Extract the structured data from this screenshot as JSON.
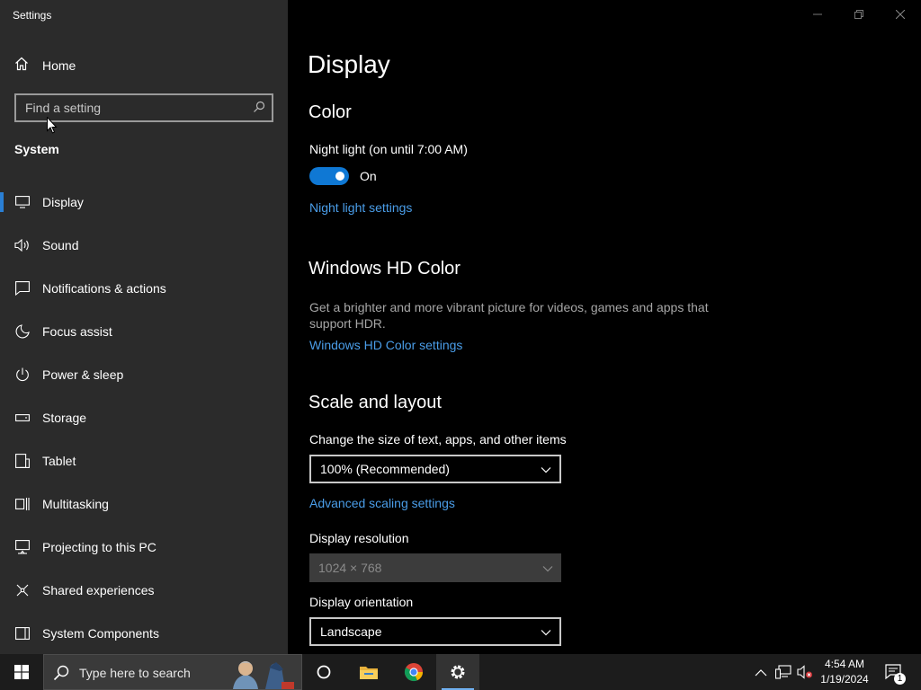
{
  "app": {
    "title": "Settings"
  },
  "sidebar": {
    "home_label": "Home",
    "search_placeholder": "Find a setting",
    "section_label": "System",
    "items": [
      {
        "label": "Display",
        "icon": "monitor-icon",
        "selected": true
      },
      {
        "label": "Sound",
        "icon": "speaker-icon"
      },
      {
        "label": "Notifications & actions",
        "icon": "notification-icon"
      },
      {
        "label": "Focus assist",
        "icon": "moon-icon"
      },
      {
        "label": "Power & sleep",
        "icon": "power-icon"
      },
      {
        "label": "Storage",
        "icon": "storage-icon"
      },
      {
        "label": "Tablet",
        "icon": "tablet-icon"
      },
      {
        "label": "Multitasking",
        "icon": "multitasking-icon"
      },
      {
        "label": "Projecting to this PC",
        "icon": "projecting-icon"
      },
      {
        "label": "Shared experiences",
        "icon": "shared-experiences-icon"
      },
      {
        "label": "System Components",
        "icon": "system-components-icon"
      }
    ]
  },
  "main": {
    "page_title": "Display",
    "color": {
      "heading": "Color",
      "night_light_label": "Night light (on until 7:00 AM)",
      "toggle_state": "On",
      "night_light_link": "Night light settings"
    },
    "hd_color": {
      "heading": "Windows HD Color",
      "description": "Get a brighter and more vibrant picture for videos, games and apps that support HDR.",
      "link": "Windows HD Color settings"
    },
    "scale_layout": {
      "heading": "Scale and layout",
      "size_label": "Change the size of text, apps, and other items",
      "size_value": "100% (Recommended)",
      "advanced_link": "Advanced scaling settings",
      "resolution_label": "Display resolution",
      "resolution_value": "1024 × 768",
      "orientation_label": "Display orientation",
      "orientation_value": "Landscape"
    }
  },
  "taskbar": {
    "search_text": "Type here to search",
    "clock_time": "4:54 AM",
    "clock_date": "1/19/2024",
    "notification_count": "1"
  },
  "colors": {
    "accent": "#0f78d4",
    "link": "#4a9de8",
    "sidebar_bg": "#2b2b2b",
    "main_bg": "#000000"
  }
}
